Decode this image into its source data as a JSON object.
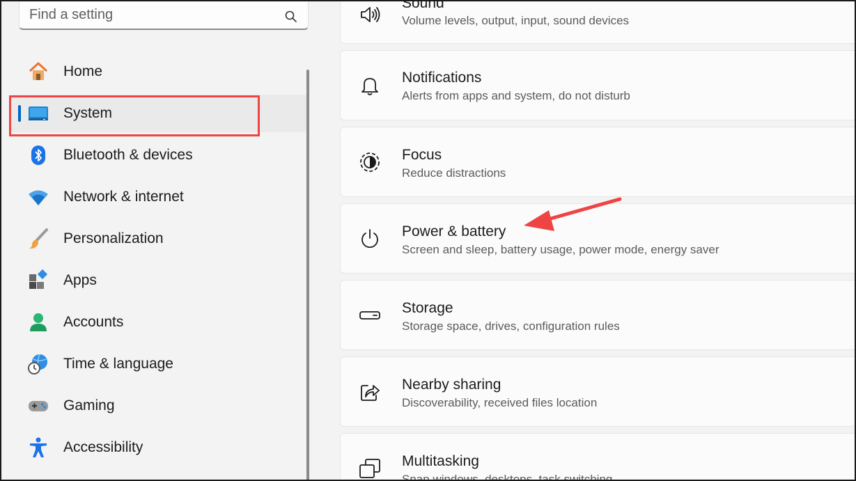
{
  "search": {
    "placeholder": "Find a setting",
    "icon": "search-icon"
  },
  "sidebar": {
    "items": [
      {
        "label": "Home",
        "icon": "home-icon",
        "selected": false
      },
      {
        "label": "System",
        "icon": "system-monitor-icon",
        "selected": true
      },
      {
        "label": "Bluetooth & devices",
        "icon": "bluetooth-icon",
        "selected": false
      },
      {
        "label": "Network & internet",
        "icon": "wifi-icon",
        "selected": false
      },
      {
        "label": "Personalization",
        "icon": "paintbrush-icon",
        "selected": false
      },
      {
        "label": "Apps",
        "icon": "apps-icon",
        "selected": false
      },
      {
        "label": "Accounts",
        "icon": "person-icon",
        "selected": false
      },
      {
        "label": "Time & language",
        "icon": "globe-clock-icon",
        "selected": false
      },
      {
        "label": "Gaming",
        "icon": "gamepad-icon",
        "selected": false
      },
      {
        "label": "Accessibility",
        "icon": "accessibility-icon",
        "selected": false
      }
    ]
  },
  "content": {
    "cards": [
      {
        "title": "Sound",
        "subtitle": "Volume levels, output, input, sound devices",
        "icon": "speaker-icon"
      },
      {
        "title": "Notifications",
        "subtitle": "Alerts from apps and system, do not disturb",
        "icon": "bell-icon"
      },
      {
        "title": "Focus",
        "subtitle": "Reduce distractions",
        "icon": "focus-icon"
      },
      {
        "title": "Power & battery",
        "subtitle": "Screen and sleep, battery usage, power mode, energy saver",
        "icon": "power-icon"
      },
      {
        "title": "Storage",
        "subtitle": "Storage space, drives, configuration rules",
        "icon": "storage-drive-icon"
      },
      {
        "title": "Nearby sharing",
        "subtitle": "Discoverability, received files location",
        "icon": "share-icon"
      },
      {
        "title": "Multitasking",
        "subtitle": "Snap windows, desktops, task switching",
        "icon": "multitasking-icon"
      }
    ]
  },
  "colors": {
    "accent": "#0067c0",
    "annotation": "#ef4444",
    "background": "#f3f3f3",
    "card": "#fbfbfb"
  }
}
